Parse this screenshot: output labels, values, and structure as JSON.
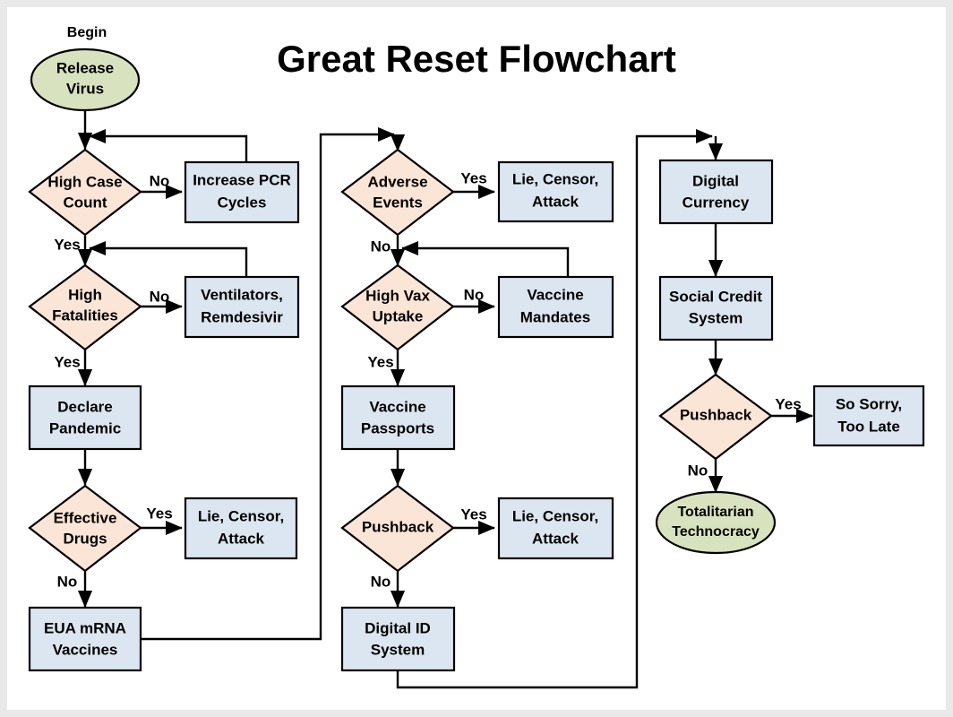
{
  "page": {
    "title": "Great Reset Flowchart",
    "background": "#e9e9e9",
    "paper": "#ffffff"
  },
  "colors": {
    "process_fill": "#dce6f1",
    "decision_fill": "#fbe5d6",
    "terminator_fill": "#d9e2bf",
    "stroke": "#000000",
    "text": "#000000"
  },
  "annotations": {
    "begin": "Begin"
  },
  "nodes": {
    "release_virus": {
      "type": "terminator",
      "line1": "Release",
      "line2": "Virus"
    },
    "high_case_count": {
      "type": "decision",
      "line1": "High Case",
      "line2": "Count"
    },
    "increase_pcr_cycles": {
      "type": "process",
      "line1": "Increase PCR",
      "line2": "Cycles"
    },
    "high_fatalities": {
      "type": "decision",
      "line1": "High",
      "line2": "Fatalities"
    },
    "ventilators": {
      "type": "process",
      "line1": "Ventilators,",
      "line2": "Remdesivir"
    },
    "declare_pandemic": {
      "type": "process",
      "line1": "Declare",
      "line2": "Pandemic"
    },
    "effective_drugs": {
      "type": "decision",
      "line1": "Effective",
      "line2": "Drugs"
    },
    "lie_censor_attack_1": {
      "type": "process",
      "line1": "Lie, Censor,",
      "line2": "Attack"
    },
    "eua_mrna_vaccines": {
      "type": "process",
      "line1": "EUA mRNA",
      "line2": "Vaccines"
    },
    "adverse_events": {
      "type": "decision",
      "line1": "Adverse",
      "line2": "Events"
    },
    "lie_censor_attack_2": {
      "type": "process",
      "line1": "Lie, Censor,",
      "line2": "Attack"
    },
    "high_vax_uptake": {
      "type": "decision",
      "line1": "High Vax",
      "line2": "Uptake"
    },
    "vaccine_mandates": {
      "type": "process",
      "line1": "Vaccine",
      "line2": "Mandates"
    },
    "vaccine_passports": {
      "type": "process",
      "line1": "Vaccine",
      "line2": "Passports"
    },
    "pushback_mid": {
      "type": "decision",
      "line1": "Pushback",
      "line2": ""
    },
    "lie_censor_attack_3": {
      "type": "process",
      "line1": "Lie, Censor,",
      "line2": "Attack"
    },
    "digital_id_system": {
      "type": "process",
      "line1": "Digital ID",
      "line2": "System"
    },
    "digital_currency": {
      "type": "process",
      "line1": "Digital",
      "line2": "Currency"
    },
    "social_credit": {
      "type": "process",
      "line1": "Social Credit",
      "line2": "System"
    },
    "pushback_right": {
      "type": "decision",
      "line1": "Pushback",
      "line2": ""
    },
    "so_sorry_too_late": {
      "type": "process",
      "line1": "So Sorry,",
      "line2": "Too Late"
    },
    "totalitarian": {
      "type": "terminator",
      "line1": "Totalitarian",
      "line2": "Technocracy"
    }
  },
  "edge_labels": {
    "hcc_no": "No",
    "hcc_yes": "Yes",
    "hf_no": "No",
    "hf_yes": "Yes",
    "ed_yes": "Yes",
    "ed_no": "No",
    "ae_yes": "Yes",
    "ae_no": "No",
    "hvu_no": "No",
    "hvu_yes": "Yes",
    "pbm_yes": "Yes",
    "pbm_no": "No",
    "pbr_yes": "Yes",
    "pbr_no": "No"
  },
  "chart_data": {
    "type": "diagram",
    "title": "Great Reset Flowchart",
    "edges": [
      {
        "from": "release_virus",
        "to": "high_case_count",
        "label": ""
      },
      {
        "from": "high_case_count",
        "to": "increase_pcr_cycles",
        "label": "No"
      },
      {
        "from": "increase_pcr_cycles",
        "to": "high_case_count",
        "label": ""
      },
      {
        "from": "high_case_count",
        "to": "high_fatalities",
        "label": "Yes"
      },
      {
        "from": "high_fatalities",
        "to": "ventilators",
        "label": "No"
      },
      {
        "from": "ventilators",
        "to": "high_fatalities",
        "label": ""
      },
      {
        "from": "high_fatalities",
        "to": "declare_pandemic",
        "label": "Yes"
      },
      {
        "from": "declare_pandemic",
        "to": "effective_drugs",
        "label": ""
      },
      {
        "from": "effective_drugs",
        "to": "lie_censor_attack_1",
        "label": "Yes"
      },
      {
        "from": "effective_drugs",
        "to": "eua_mrna_vaccines",
        "label": "No"
      },
      {
        "from": "eua_mrna_vaccines",
        "to": "adverse_events",
        "label": ""
      },
      {
        "from": "adverse_events",
        "to": "lie_censor_attack_2",
        "label": "Yes"
      },
      {
        "from": "adverse_events",
        "to": "high_vax_uptake",
        "label": "No"
      },
      {
        "from": "high_vax_uptake",
        "to": "vaccine_mandates",
        "label": "No"
      },
      {
        "from": "vaccine_mandates",
        "to": "high_vax_uptake",
        "label": ""
      },
      {
        "from": "high_vax_uptake",
        "to": "vaccine_passports",
        "label": "Yes"
      },
      {
        "from": "vaccine_passports",
        "to": "pushback_mid",
        "label": ""
      },
      {
        "from": "pushback_mid",
        "to": "lie_censor_attack_3",
        "label": "Yes"
      },
      {
        "from": "pushback_mid",
        "to": "digital_id_system",
        "label": "No"
      },
      {
        "from": "digital_id_system",
        "to": "digital_currency",
        "label": ""
      },
      {
        "from": "digital_currency",
        "to": "social_credit",
        "label": ""
      },
      {
        "from": "social_credit",
        "to": "pushback_right",
        "label": ""
      },
      {
        "from": "pushback_right",
        "to": "so_sorry_too_late",
        "label": "Yes"
      },
      {
        "from": "pushback_right",
        "to": "totalitarian",
        "label": "No"
      }
    ]
  }
}
